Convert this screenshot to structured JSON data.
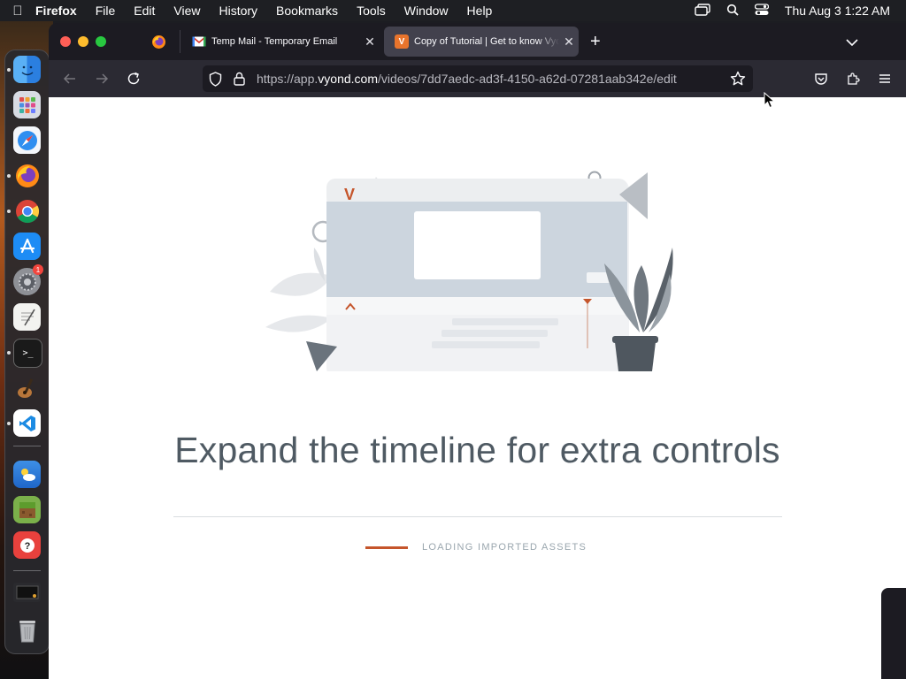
{
  "menubar": {
    "app_name": "Firefox",
    "menus": [
      "File",
      "Edit",
      "View",
      "History",
      "Bookmarks",
      "Tools",
      "Window",
      "Help"
    ],
    "clock": "Thu Aug 3  1:22 AM"
  },
  "dock": {
    "apps": [
      "Finder",
      "Launchpad",
      "Safari",
      "Firefox",
      "Chrome",
      "App Store",
      "System Settings",
      "TextEdit",
      "Terminal",
      "GarageBand",
      "Visual Studio Code",
      "Weather",
      "Minecraft",
      "Tips",
      "Screen",
      "Trash"
    ],
    "settings_badge": "1"
  },
  "browser": {
    "tabs": [
      {
        "title": "Temp Mail - Temporary Email",
        "favicon": "mail-icon"
      },
      {
        "title": "Copy of Tutorial | Get to know Vyond",
        "favicon": "vyond-icon"
      }
    ],
    "url_prefix": "https://app.",
    "url_domain": "vyond.com",
    "url_path": "/videos/7dd7aedc-ad3f-4150-a62d-07281aab342e/edit"
  },
  "page": {
    "headline": "Expand the timeline for extra controls",
    "loading_label": "LOADING IMPORTED ASSETS",
    "illustration_logo": "V"
  },
  "colors": {
    "accent": "#c5552b",
    "headline": "#4f5a63",
    "muted": "#9aa6ae"
  }
}
